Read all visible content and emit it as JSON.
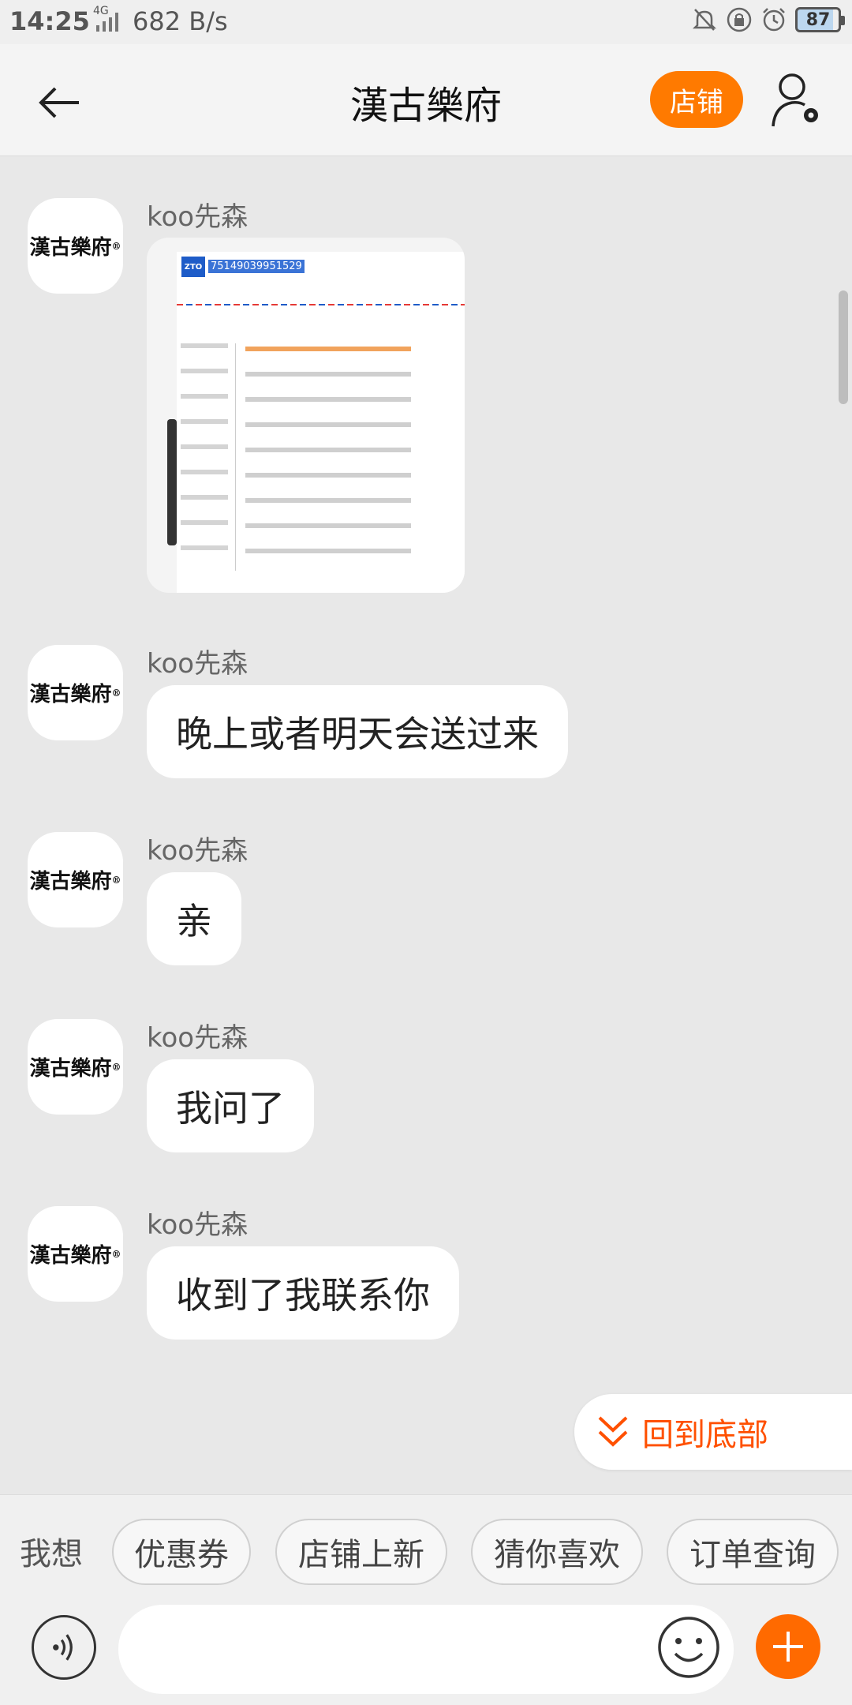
{
  "status_bar": {
    "time": "14:25",
    "network": "4G",
    "speed": "682 B/s",
    "battery": "87"
  },
  "header": {
    "title": "漢古樂府",
    "shop_label": "店铺"
  },
  "avatar": {
    "brand": "漢古樂府",
    "mark": "®"
  },
  "messages": [
    {
      "sender": "koo先森",
      "type": "image",
      "image_text": "75149039951529"
    },
    {
      "sender": "koo先森",
      "type": "text",
      "text": "晚上或者明天会送过来"
    },
    {
      "sender": "koo先森",
      "type": "text",
      "text": "亲"
    },
    {
      "sender": "koo先森",
      "type": "text",
      "text": "我问了"
    },
    {
      "sender": "koo先森",
      "type": "text",
      "text": "收到了我联系你"
    }
  ],
  "back_to_bottom": "回到底部",
  "quick_bar": {
    "label": "我想",
    "chips": [
      "优惠券",
      "店铺上新",
      "猜你喜欢",
      "订单查询"
    ]
  },
  "input": {
    "placeholder": ""
  },
  "colors": {
    "accent": "#ff7a00",
    "link": "#ff5000"
  }
}
